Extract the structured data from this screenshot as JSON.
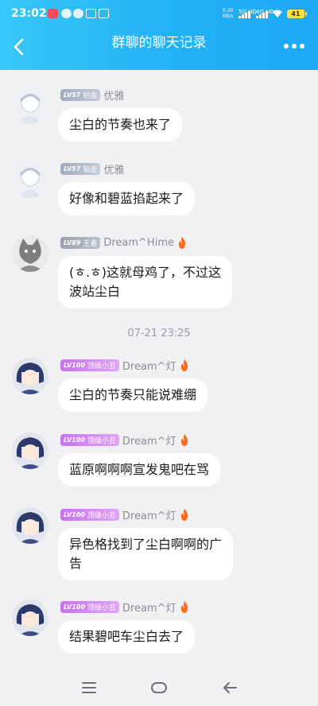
{
  "status_bar": {
    "time": "23:02",
    "speed_value": "0.20",
    "speed_unit": "KB/s",
    "sim1_label": "5G HD",
    "sim2_label": "4G HD",
    "battery": "41"
  },
  "header": {
    "title": "群聊的聊天记录"
  },
  "messages": [
    {
      "level": "LV57",
      "badge": "铂金",
      "nickname": "优雅",
      "flame": false,
      "text": "尘白的节奏也来了"
    },
    {
      "level": "LV57",
      "badge": "铂金",
      "nickname": "优雅",
      "flame": false,
      "text": "好像和碧蓝掐起来了"
    },
    {
      "level": "LV89",
      "badge": "王者",
      "nickname": "Dream^Hime",
      "flame": true,
      "text_lines": [
        "(ㅎ.ㅎ)这就母鸡了，不过这",
        "波站尘白"
      ]
    },
    {
      "level": "LV100",
      "badge": "顶级小丑",
      "nickname": "Dream^灯",
      "flame": true,
      "text": "尘白的节奏只能说难绷"
    },
    {
      "level": "LV100",
      "badge": "顶级小丑",
      "nickname": "Dream^灯",
      "flame": true,
      "text": "蓝原啊啊啊宣发鬼吧在骂"
    },
    {
      "level": "LV100",
      "badge": "顶级小丑",
      "nickname": "Dream^灯",
      "flame": true,
      "text_lines": [
        "异色格找到了尘白啊啊的广",
        "告"
      ]
    },
    {
      "level": "LV100",
      "badge": "顶级小丑",
      "nickname": "Dream^灯",
      "flame": true,
      "text": "结果碧吧车尘白去了"
    }
  ],
  "timestamp": "07-21 23:25",
  "nav_icons": [
    "menu-icon",
    "home-icon",
    "back-arrow-icon"
  ],
  "colors": {
    "header_blue": "#22b1f6",
    "badge_purple": "#c873ee",
    "flame": "#ff6a1a"
  }
}
